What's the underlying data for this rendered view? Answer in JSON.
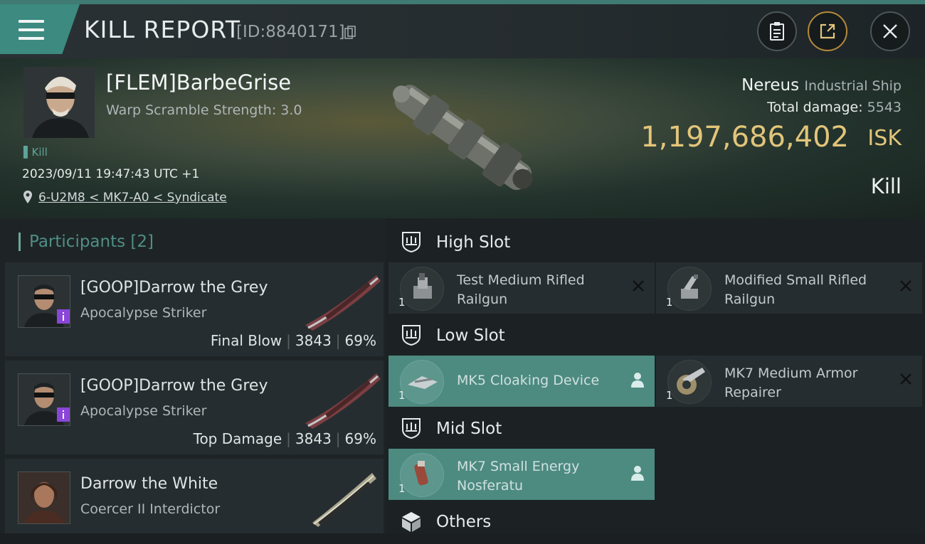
{
  "header": {
    "title": "KILL REPORT",
    "kill_id": "[ID:8840171]"
  },
  "victim": {
    "pilot_name": "[FLEM]BarbeGrise",
    "warp_scramble": "Warp Scramble Strength: 3.0",
    "tag": "Kill",
    "datetime": "2023/09/11 19:47:43 UTC +1",
    "location": "6-U2M8 < MK7-A0 < Syndicate",
    "ship_name": "Nereus",
    "ship_class": "Industrial Ship",
    "total_damage_label": "Total damage:",
    "total_damage": "5543",
    "isk_value": "1,197,686,402",
    "isk_unit": "ISK",
    "status": "Kill"
  },
  "participants": {
    "label": "Participants",
    "count": "[2]",
    "items": [
      {
        "name": "[GOOP]Darrow the Grey",
        "ship": "Apocalypse Striker",
        "role": "Final Blow",
        "damage": "3843",
        "percent": "69%"
      },
      {
        "name": "[GOOP]Darrow the Grey",
        "ship": "Apocalypse Striker",
        "role": "Top Damage",
        "damage": "3843",
        "percent": "69%"
      },
      {
        "name": "Darrow the White",
        "ship": "Coercer II Interdictor"
      }
    ]
  },
  "slots": {
    "high": {
      "title": "High Slot",
      "items": [
        {
          "name": "Test Medium Rifled Railgun",
          "qty": "1"
        },
        {
          "name": "Modified Small Rifled Railgun",
          "qty": "1"
        }
      ]
    },
    "low": {
      "title": "Low Slot",
      "items": [
        {
          "name": "MK5 Cloaking Device",
          "qty": "1"
        },
        {
          "name": "MK7 Medium Armor Repairer",
          "qty": "1"
        }
      ]
    },
    "mid": {
      "title": "Mid Slot",
      "items": [
        {
          "name": "MK7 Small Energy Nosferatu",
          "qty": "1"
        }
      ]
    },
    "others": {
      "title": "Others"
    }
  },
  "icons": {
    "menu": "menu-icon",
    "copy": "copy-icon",
    "clipboard": "clipboard-icon",
    "share": "share-icon",
    "close": "close-icon",
    "location": "location-pin-icon",
    "slot": "slot-icon",
    "dropped": "person-icon",
    "destroyed": "x-icon"
  },
  "colors": {
    "accent": "#3c8a80",
    "isk": "#e2c57a",
    "dropped_item": "#4d8a80",
    "badge": "#8a46d9"
  }
}
